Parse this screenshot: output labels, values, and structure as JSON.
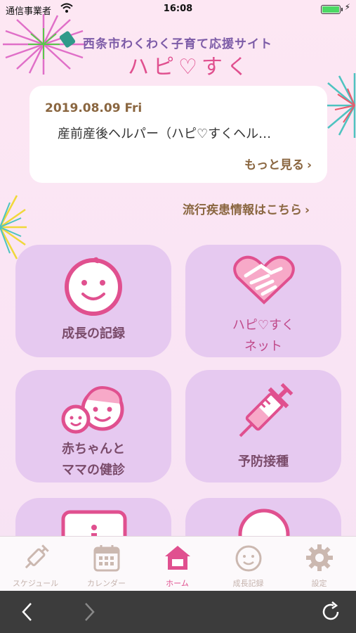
{
  "status_bar": {
    "carrier": "通信事業者",
    "time": "16:08"
  },
  "header": {
    "site_title": "西条市わくわく子育て応援サイト",
    "app_logo": "ハピ♡すく"
  },
  "news": {
    "date": "2019.08.09 Fri",
    "title": "産前産後ヘルパー（ハピ♡すくヘル…",
    "more_label": "もっと見る"
  },
  "disease_link": "流行疾患情報はこちら",
  "tiles": [
    {
      "label": "成長の記録"
    },
    {
      "label_line1": "ハピ♡すく",
      "label_line2": "ネット"
    },
    {
      "label_line1": "赤ちゃんと",
      "label_line2": "ママの健診"
    },
    {
      "label": "予防接種"
    }
  ],
  "tabbar": [
    {
      "label": "スケジュール"
    },
    {
      "label": "カレンダー"
    },
    {
      "label": "ホーム"
    },
    {
      "label": "成長記録"
    },
    {
      "label": "設定"
    }
  ],
  "colors": {
    "accent": "#e0508f",
    "tile": "#e6c9f0",
    "brown": "#8a6640",
    "purple": "#7c5ba7"
  }
}
